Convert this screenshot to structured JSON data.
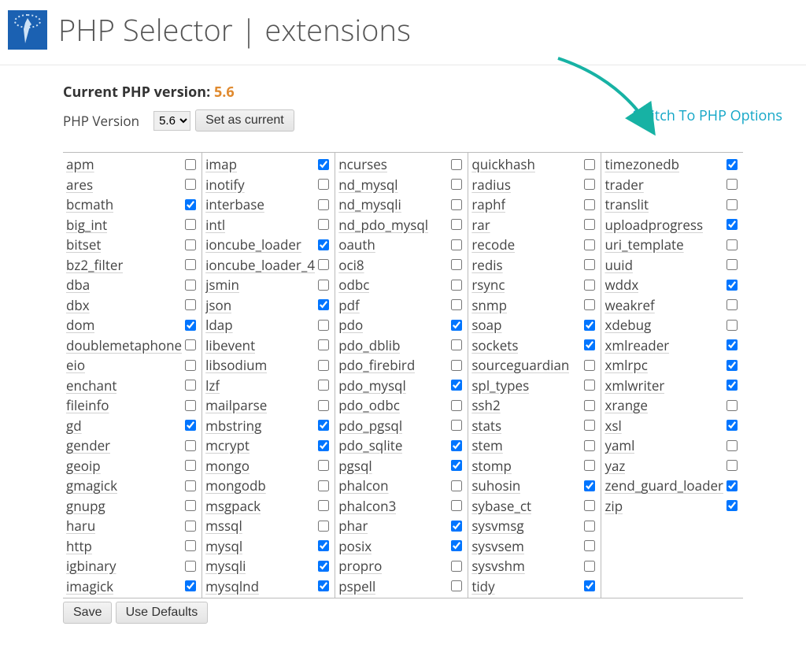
{
  "header": {
    "title": "PHP Selector | extensions"
  },
  "current": {
    "label": "Current PHP version:",
    "value": "5.6"
  },
  "version": {
    "label": "PHP Version",
    "selected": "5.6",
    "set_button": "Set as current"
  },
  "switch_link": "Switch To PHP Options",
  "buttons": {
    "save": "Save",
    "defaults": "Use Defaults"
  },
  "columns": [
    [
      {
        "name": "apm",
        "checked": false
      },
      {
        "name": "ares",
        "checked": false
      },
      {
        "name": "bcmath",
        "checked": true
      },
      {
        "name": "big_int",
        "checked": false
      },
      {
        "name": "bitset",
        "checked": false
      },
      {
        "name": "bz2_filter",
        "checked": false
      },
      {
        "name": "dba",
        "checked": false
      },
      {
        "name": "dbx",
        "checked": false
      },
      {
        "name": "dom",
        "checked": true
      },
      {
        "name": "doublemetaphone",
        "checked": false
      },
      {
        "name": "eio",
        "checked": false
      },
      {
        "name": "enchant",
        "checked": false
      },
      {
        "name": "fileinfo",
        "checked": false
      },
      {
        "name": "gd",
        "checked": true
      },
      {
        "name": "gender",
        "checked": false
      },
      {
        "name": "geoip",
        "checked": false
      },
      {
        "name": "gmagick",
        "checked": false
      },
      {
        "name": "gnupg",
        "checked": false
      },
      {
        "name": "haru",
        "checked": false
      },
      {
        "name": "http",
        "checked": false
      },
      {
        "name": "igbinary",
        "checked": false
      },
      {
        "name": "imagick",
        "checked": true
      }
    ],
    [
      {
        "name": "imap",
        "checked": true
      },
      {
        "name": "inotify",
        "checked": false
      },
      {
        "name": "interbase",
        "checked": false
      },
      {
        "name": "intl",
        "checked": false
      },
      {
        "name": "ioncube_loader",
        "checked": true
      },
      {
        "name": "ioncube_loader_4",
        "checked": false
      },
      {
        "name": "jsmin",
        "checked": false
      },
      {
        "name": "json",
        "checked": true
      },
      {
        "name": "ldap",
        "checked": false
      },
      {
        "name": "libevent",
        "checked": false
      },
      {
        "name": "libsodium",
        "checked": false
      },
      {
        "name": "lzf",
        "checked": false
      },
      {
        "name": "mailparse",
        "checked": false
      },
      {
        "name": "mbstring",
        "checked": true
      },
      {
        "name": "mcrypt",
        "checked": true
      },
      {
        "name": "mongo",
        "checked": false
      },
      {
        "name": "mongodb",
        "checked": false
      },
      {
        "name": "msgpack",
        "checked": false
      },
      {
        "name": "mssql",
        "checked": false
      },
      {
        "name": "mysql",
        "checked": true
      },
      {
        "name": "mysqli",
        "checked": true
      },
      {
        "name": "mysqlnd",
        "checked": true
      }
    ],
    [
      {
        "name": "ncurses",
        "checked": false
      },
      {
        "name": "nd_mysql",
        "checked": false
      },
      {
        "name": "nd_mysqli",
        "checked": false
      },
      {
        "name": "nd_pdo_mysql",
        "checked": false
      },
      {
        "name": "oauth",
        "checked": false
      },
      {
        "name": "oci8",
        "checked": false
      },
      {
        "name": "odbc",
        "checked": false
      },
      {
        "name": "pdf",
        "checked": false
      },
      {
        "name": "pdo",
        "checked": true
      },
      {
        "name": "pdo_dblib",
        "checked": false
      },
      {
        "name": "pdo_firebird",
        "checked": false
      },
      {
        "name": "pdo_mysql",
        "checked": true
      },
      {
        "name": "pdo_odbc",
        "checked": false
      },
      {
        "name": "pdo_pgsql",
        "checked": false
      },
      {
        "name": "pdo_sqlite",
        "checked": true
      },
      {
        "name": "pgsql",
        "checked": true
      },
      {
        "name": "phalcon",
        "checked": false
      },
      {
        "name": "phalcon3",
        "checked": false
      },
      {
        "name": "phar",
        "checked": true
      },
      {
        "name": "posix",
        "checked": true
      },
      {
        "name": "propro",
        "checked": false
      },
      {
        "name": "pspell",
        "checked": false
      }
    ],
    [
      {
        "name": "quickhash",
        "checked": false
      },
      {
        "name": "radius",
        "checked": false
      },
      {
        "name": "raphf",
        "checked": false
      },
      {
        "name": "rar",
        "checked": false
      },
      {
        "name": "recode",
        "checked": false
      },
      {
        "name": "redis",
        "checked": false
      },
      {
        "name": "rsync",
        "checked": false
      },
      {
        "name": "snmp",
        "checked": false
      },
      {
        "name": "soap",
        "checked": true
      },
      {
        "name": "sockets",
        "checked": true
      },
      {
        "name": "sourceguardian",
        "checked": false
      },
      {
        "name": "spl_types",
        "checked": false
      },
      {
        "name": "ssh2",
        "checked": false
      },
      {
        "name": "stats",
        "checked": false
      },
      {
        "name": "stem",
        "checked": false
      },
      {
        "name": "stomp",
        "checked": false
      },
      {
        "name": "suhosin",
        "checked": true
      },
      {
        "name": "sybase_ct",
        "checked": false
      },
      {
        "name": "sysvmsg",
        "checked": false
      },
      {
        "name": "sysvsem",
        "checked": false
      },
      {
        "name": "sysvshm",
        "checked": false
      },
      {
        "name": "tidy",
        "checked": true
      }
    ],
    [
      {
        "name": "timezonedb",
        "checked": true
      },
      {
        "name": "trader",
        "checked": false
      },
      {
        "name": "translit",
        "checked": false
      },
      {
        "name": "uploadprogress",
        "checked": true
      },
      {
        "name": "uri_template",
        "checked": false
      },
      {
        "name": "uuid",
        "checked": false
      },
      {
        "name": "wddx",
        "checked": true
      },
      {
        "name": "weakref",
        "checked": false
      },
      {
        "name": "xdebug",
        "checked": false
      },
      {
        "name": "xmlreader",
        "checked": true
      },
      {
        "name": "xmlrpc",
        "checked": true
      },
      {
        "name": "xmlwriter",
        "checked": true
      },
      {
        "name": "xrange",
        "checked": false
      },
      {
        "name": "xsl",
        "checked": true
      },
      {
        "name": "yaml",
        "checked": false
      },
      {
        "name": "yaz",
        "checked": false
      },
      {
        "name": "zend_guard_loader",
        "checked": true
      },
      {
        "name": "zip",
        "checked": true
      }
    ]
  ]
}
